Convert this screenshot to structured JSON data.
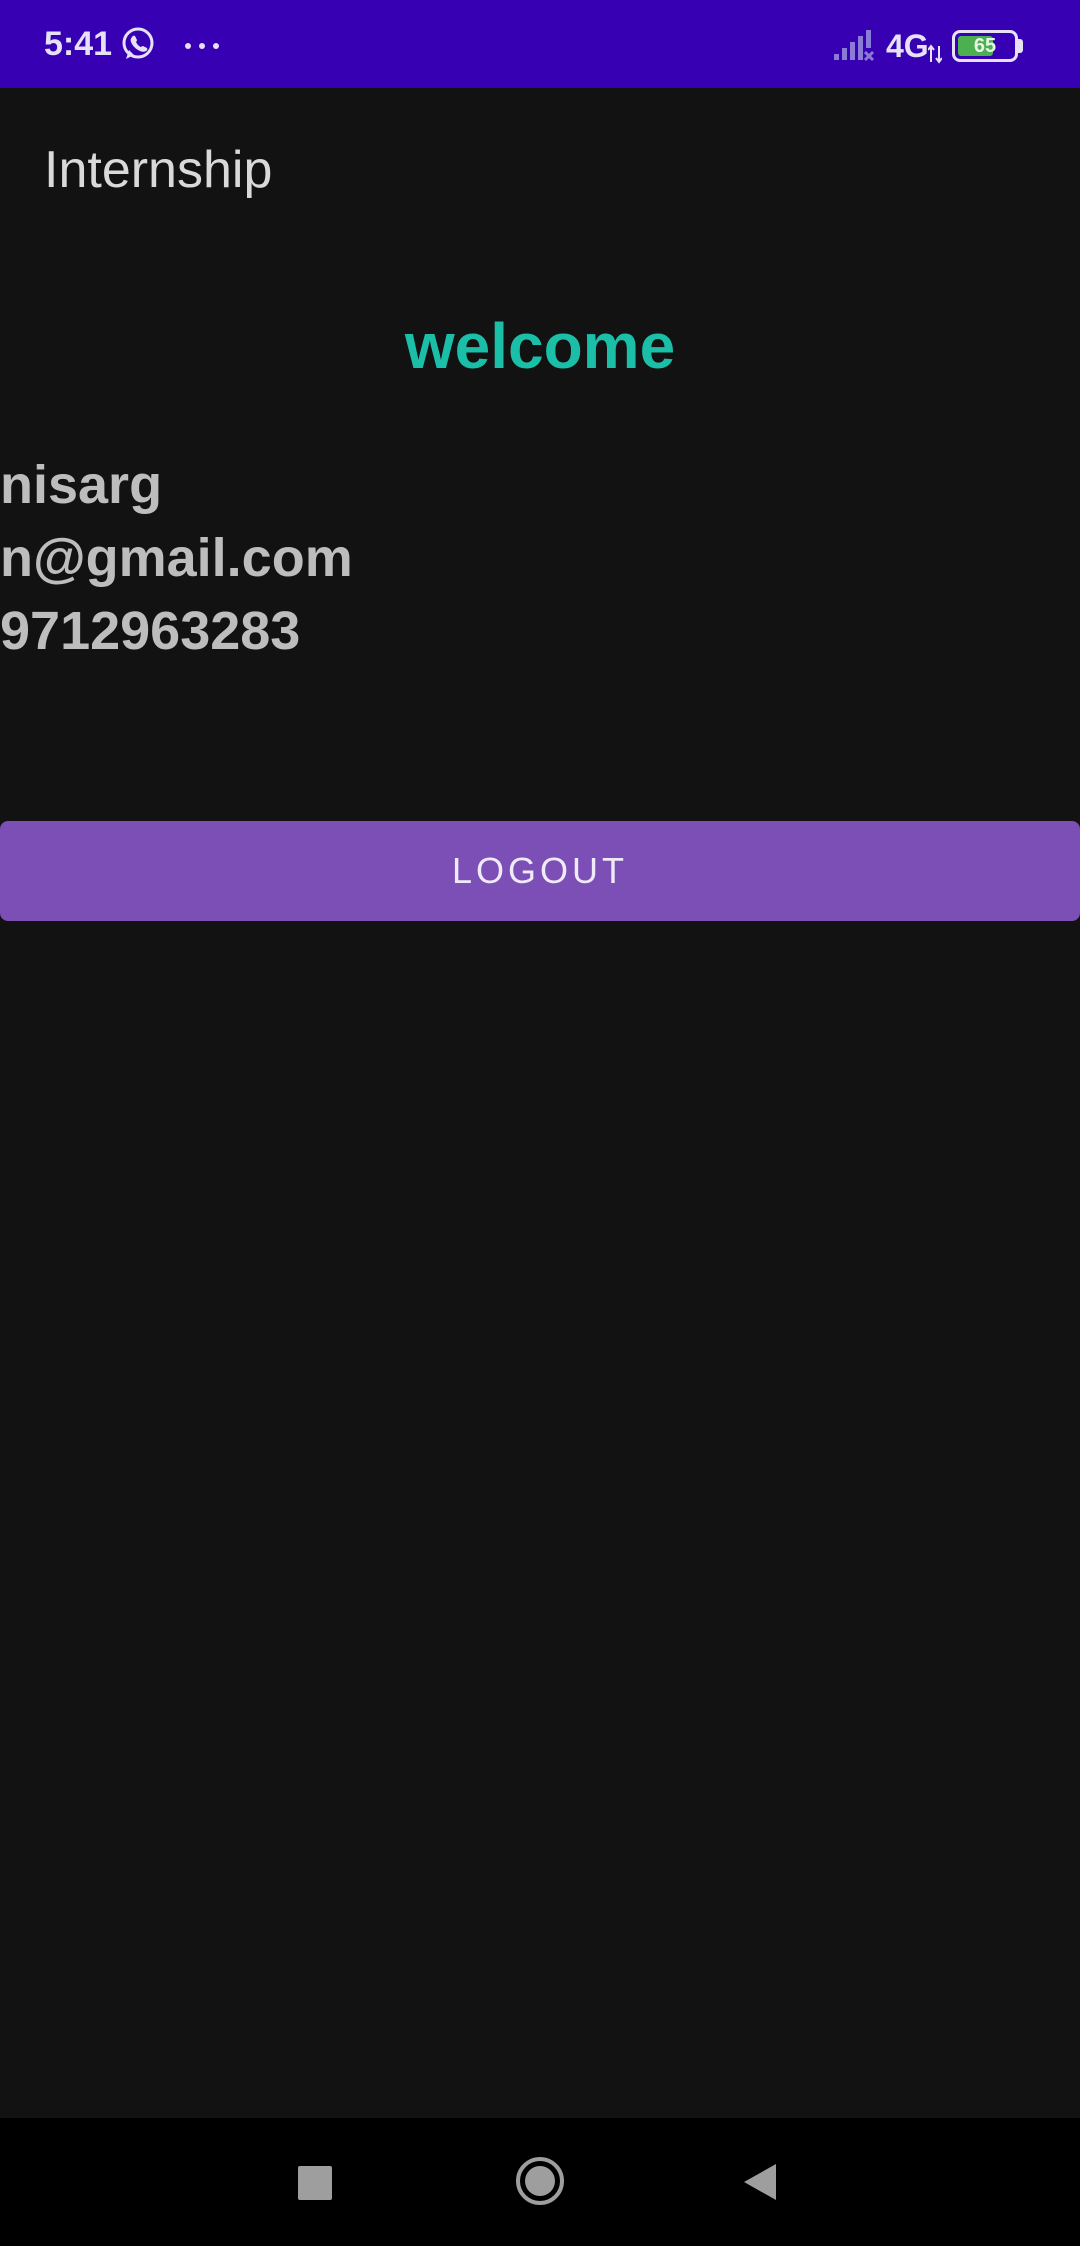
{
  "status_bar": {
    "time": "5:41",
    "network": "4G",
    "battery_percent": "65",
    "battery_level": 0.65,
    "icons": [
      "whatsapp-icon",
      "more-dots-icon",
      "signal-icon",
      "network-arrows-icon",
      "battery-icon"
    ]
  },
  "app_bar": {
    "title": "Internship"
  },
  "main": {
    "welcome": "welcome",
    "name": "nisarg",
    "email": "n@gmail.com",
    "phone": "9712963283",
    "logout_label": "LOGOUT"
  },
  "nav_bar": {
    "icons": [
      "recents-icon",
      "home-icon",
      "back-icon"
    ]
  },
  "colors": {
    "status_bar": "#3700b3",
    "background": "#121212",
    "welcome_text": "#1bbfa8",
    "button": "#7b4fb6",
    "info_text": "#bdbdbd"
  }
}
